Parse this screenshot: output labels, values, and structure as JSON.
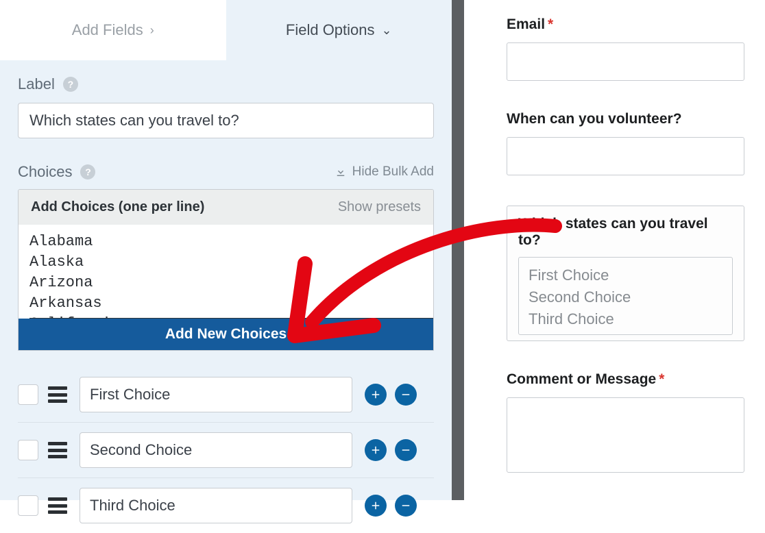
{
  "tabs": {
    "add_fields": "Add Fields",
    "field_options": "Field Options"
  },
  "labels": {
    "label": "Label",
    "choices": "Choices",
    "hide_bulk": "Hide Bulk Add",
    "add_choices_title": "Add Choices (one per line)",
    "show_presets": "Show presets",
    "add_new_choices": "Add New Choices"
  },
  "field": {
    "label_value": "Which states can you travel to?"
  },
  "bulk_text": "Alabama\nAlaska\nArizona\nArkansas\nCalifornia",
  "choices": [
    {
      "label": "First Choice"
    },
    {
      "label": "Second Choice"
    },
    {
      "label": "Third Choice"
    }
  ],
  "preview": {
    "email": {
      "label": "Email",
      "required": true
    },
    "volunteer": {
      "label": "When can you volunteer?"
    },
    "states": {
      "label": "Which states can you travel to?",
      "options": [
        "First Choice",
        "Second Choice",
        "Third Choice"
      ]
    },
    "comment": {
      "label": "Comment or Message",
      "required": true
    }
  }
}
